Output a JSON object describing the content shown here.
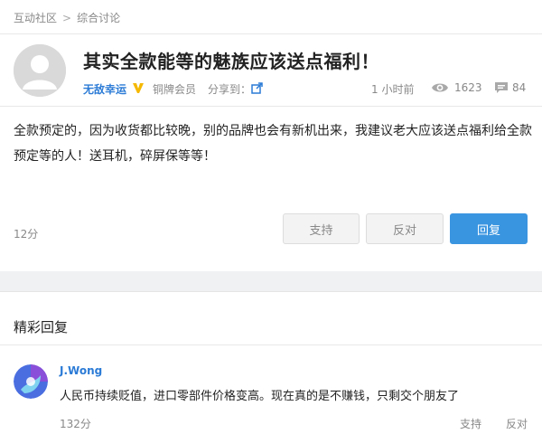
{
  "breadcrumb": {
    "home": "互动社区",
    "separator": ">",
    "current": "综合讨论"
  },
  "post": {
    "title": "其实全款能等的魅族应该送点福利！",
    "author": "无敌幸运",
    "level": "铜牌会员",
    "share_label": "分享到：",
    "time": "1 小时前",
    "views": "1623",
    "comments": "84",
    "content": "全款预定的，因为收货都比较晚，别的品牌也会有新机出来，我建议老大应该送点福利给全款预定等的人！送耳机，碎屏保等等！",
    "score": "12分",
    "support_label": "支持",
    "oppose_label": "反对",
    "reply_label": "回复"
  },
  "replies_section": {
    "title": "精彩回复",
    "items": [
      {
        "name": "J.Wong",
        "text": "人民币持续贬值，进口零部件价格变高。现在真的是不赚钱，只剩交个朋友了",
        "score": "132分",
        "support_label": "支持",
        "oppose_label": "反对"
      }
    ]
  },
  "colors": {
    "accent": "#3a95e0",
    "link": "#2b7bd6",
    "badge": "#f5b800",
    "background": "#f0f1f3"
  },
  "icons": {
    "share": "share-icon",
    "views": "eye-icon",
    "comments": "comment-icon",
    "verified": "v-badge-icon"
  }
}
